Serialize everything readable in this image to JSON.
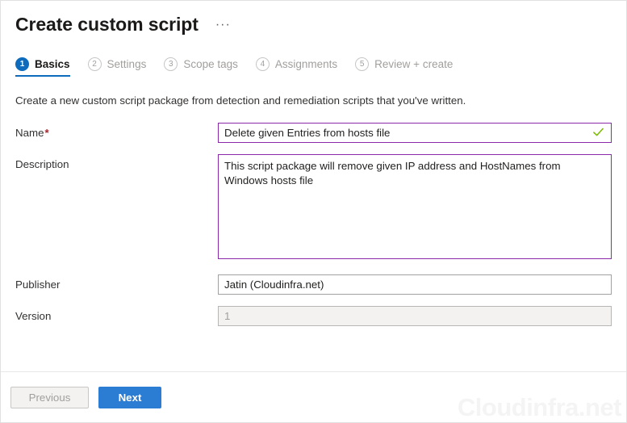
{
  "header": {
    "title": "Create custom script",
    "ellipsis_label": "···"
  },
  "wizard": {
    "steps": [
      {
        "number": "1",
        "label": "Basics",
        "state": "active"
      },
      {
        "number": "2",
        "label": "Settings",
        "state": "inactive"
      },
      {
        "number": "3",
        "label": "Scope tags",
        "state": "inactive"
      },
      {
        "number": "4",
        "label": "Assignments",
        "state": "inactive"
      },
      {
        "number": "5",
        "label": "Review + create",
        "state": "inactive"
      }
    ]
  },
  "intro": {
    "text": "Create a new custom script package from detection and remediation scripts that you've written."
  },
  "form": {
    "name": {
      "label": "Name",
      "required_marker": "*",
      "value": "Delete given Entries from hosts file",
      "placeholder": "",
      "valid_icon": "checkmark-icon"
    },
    "description": {
      "label": "Description",
      "value": "This script package will remove given IP address and HostNames from Windows hosts file",
      "placeholder": ""
    },
    "publisher": {
      "label": "Publisher",
      "value": "Jatin (Cloudinfra.net)",
      "placeholder": ""
    },
    "version": {
      "label": "Version",
      "value": "1",
      "placeholder": "",
      "disabled": true
    }
  },
  "footer": {
    "previous_label": "Previous",
    "next_label": "Next"
  },
  "watermark": {
    "text": "Cloudinfra.net"
  },
  "colors": {
    "accent_blue": "#0f6cbd",
    "primary_button": "#2b7cd3",
    "validated_border": "#8c29a8",
    "required_asterisk": "#a4262c",
    "success_check": "#7ab800",
    "inactive_step": "#a19f9d"
  }
}
